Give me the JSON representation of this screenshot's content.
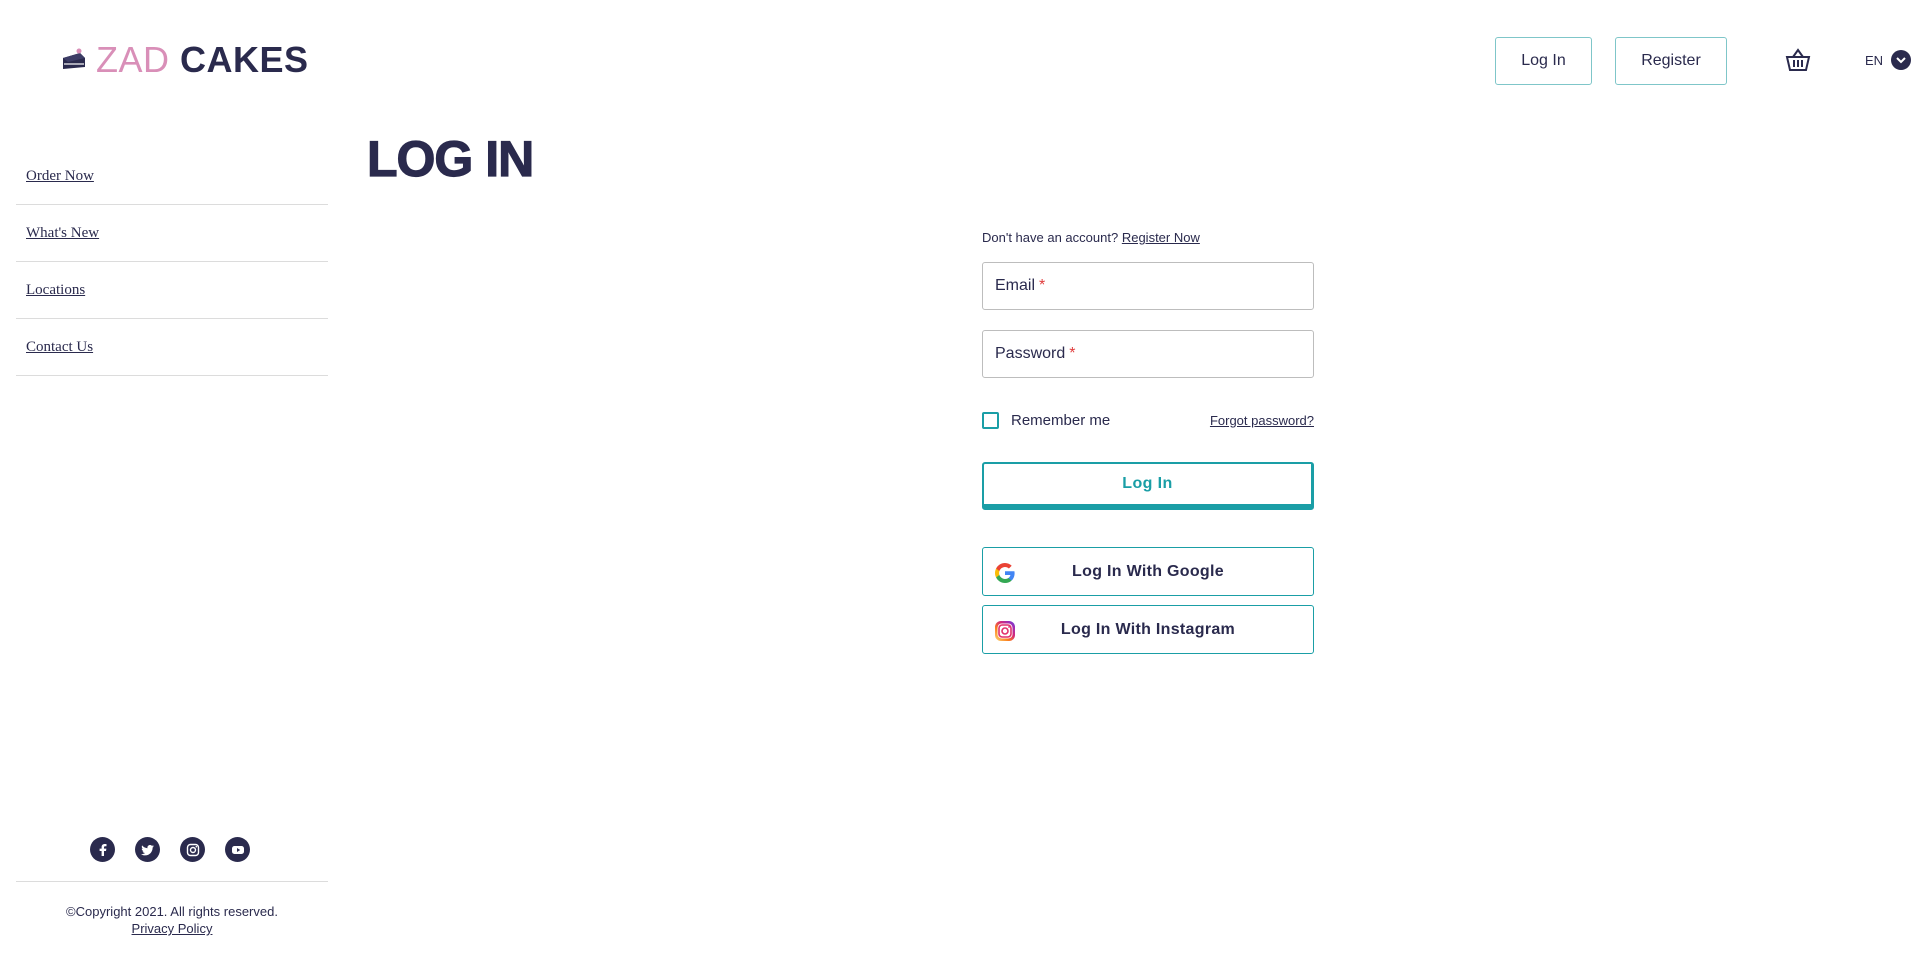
{
  "header": {
    "logo": {
      "part1": "ZAD",
      "part2": "CAKES"
    },
    "login_label": "Log In",
    "register_label": "Register",
    "lang": "EN"
  },
  "sidebar": {
    "items": [
      {
        "label": "Order Now"
      },
      {
        "label": "What's New"
      },
      {
        "label": "Locations"
      },
      {
        "label": "Contact Us"
      }
    ],
    "copyright": "©Copyright 2021. All rights reserved.",
    "privacy_label": "Privacy Policy"
  },
  "main": {
    "title": "LOG IN",
    "form": {
      "no_account_text": "Don't have an account?",
      "register_now_label": "Register Now",
      "email_label": "Email",
      "password_label": "Password",
      "required_mark": "*",
      "remember_label": "Remember me",
      "forgot_label": "Forgot password?",
      "login_button": "Log In",
      "google_button": "Log In With Google",
      "instagram_button": "Log In With Instagram"
    }
  },
  "colors": {
    "accent": "#1a9ea6",
    "navy": "#2a2a4d",
    "pink": "#d98fb8",
    "required": "#e03b3b"
  },
  "icons": [
    "cake-icon",
    "basket-icon",
    "chevron-down-icon",
    "facebook-icon",
    "twitter-icon",
    "instagram-icon",
    "youtube-icon",
    "google-icon"
  ]
}
